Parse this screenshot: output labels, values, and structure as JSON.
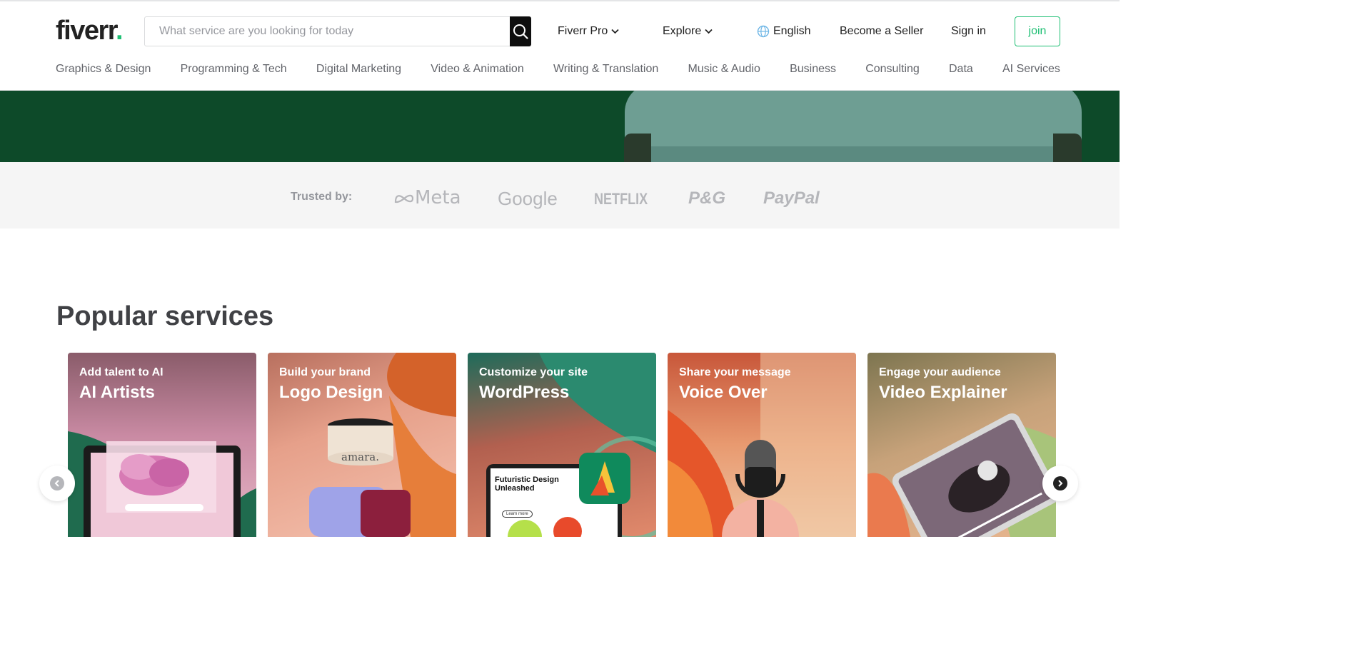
{
  "header": {
    "logo": "fiverr",
    "logo_dot": ".",
    "search_placeholder": "What service are you looking for today",
    "fiverr_pro": "Fiverr Pro",
    "explore": "Explore",
    "language": "English",
    "become_seller": "Become a Seller",
    "sign_in": "Sign in",
    "join": "join"
  },
  "categories": [
    "Graphics & Design",
    "Programming & Tech",
    "Digital Marketing",
    "Video & Animation",
    "Writing & Translation",
    "Music & Audio",
    "Business",
    "Consulting",
    "Data",
    "AI Services"
  ],
  "trusted": {
    "label": "Trusted by:",
    "brands": [
      "Meta",
      "Google",
      "NETFLIX",
      "P&G",
      "PayPal"
    ]
  },
  "popular": {
    "title": "Popular services",
    "cards": [
      {
        "subtitle": "Add talent to AI",
        "title": "AI Artists"
      },
      {
        "subtitle": "Build your brand",
        "title": "Logo Design"
      },
      {
        "subtitle": "Customize your site",
        "title": "WordPress"
      },
      {
        "subtitle": "Share your message",
        "title": "Voice Over"
      },
      {
        "subtitle": "Engage your audience",
        "title": "Video Explainer"
      }
    ],
    "card_art": {
      "jar_label": "amara.",
      "wp_screen_text": "Futuristic Design Unleashed",
      "wp_button": "Learn more"
    }
  },
  "colors": {
    "brand_green": "#1dbf73",
    "hero_green": "#0d4a29",
    "text_dark": "#404145"
  },
  "icons": {
    "search": "search-icon",
    "globe": "globe-icon",
    "chevron": "chevron-down-icon",
    "prev": "chevron-left-icon",
    "next": "chevron-right-icon"
  }
}
